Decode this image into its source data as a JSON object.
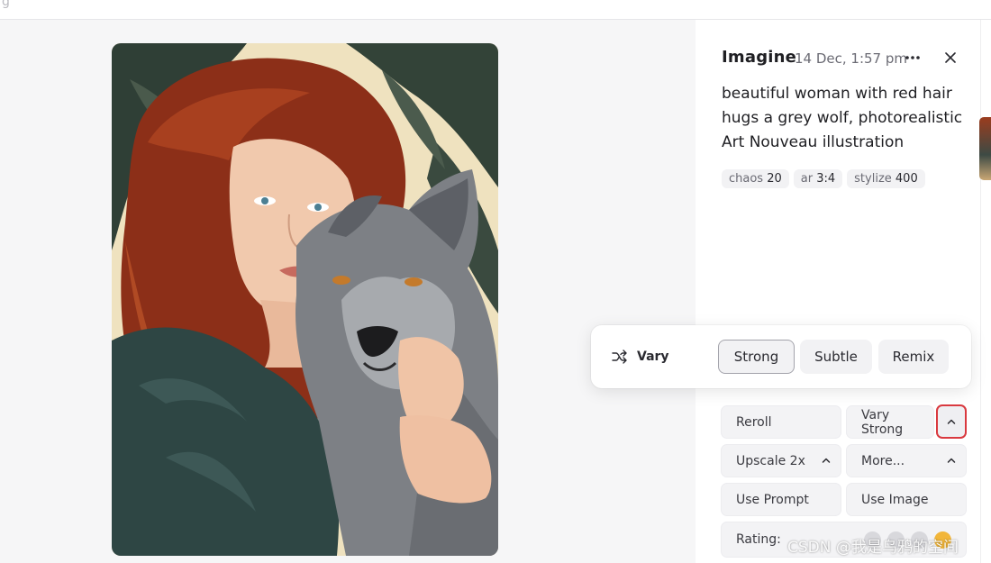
{
  "job": {
    "title": "Imagine",
    "date": "14 Dec, 1:57 pm",
    "prompt": "beautiful woman with red hair hugs a grey wolf, photorealistic Art Nouveau illustration",
    "params": [
      {
        "key": "chaos",
        "value": "20"
      },
      {
        "key": "ar",
        "value": "3:4"
      },
      {
        "key": "stylize",
        "value": "400"
      }
    ]
  },
  "vary_popover": {
    "label": "Vary",
    "options": [
      "Strong",
      "Subtle",
      "Remix"
    ],
    "selected": "Strong"
  },
  "actions": {
    "reroll": "Reroll",
    "vary_strong": "Vary Strong",
    "upscale": "Upscale 2x",
    "more": "More...",
    "use_prompt": "Use Prompt",
    "use_image": "Use Image",
    "rating_label": "Rating:"
  },
  "watermark": "CSDN @我是乌鸦的空间",
  "icons": {
    "more": "ellipsis-icon",
    "close": "close-icon",
    "vary": "shuffle-icon",
    "chevron": "chevron-up-icon",
    "rating": "emoji-icon"
  },
  "colors": {
    "accent_outline": "#d9393f",
    "panel_bg": "#ffffff",
    "canvas_bg": "#f6f6f7"
  }
}
